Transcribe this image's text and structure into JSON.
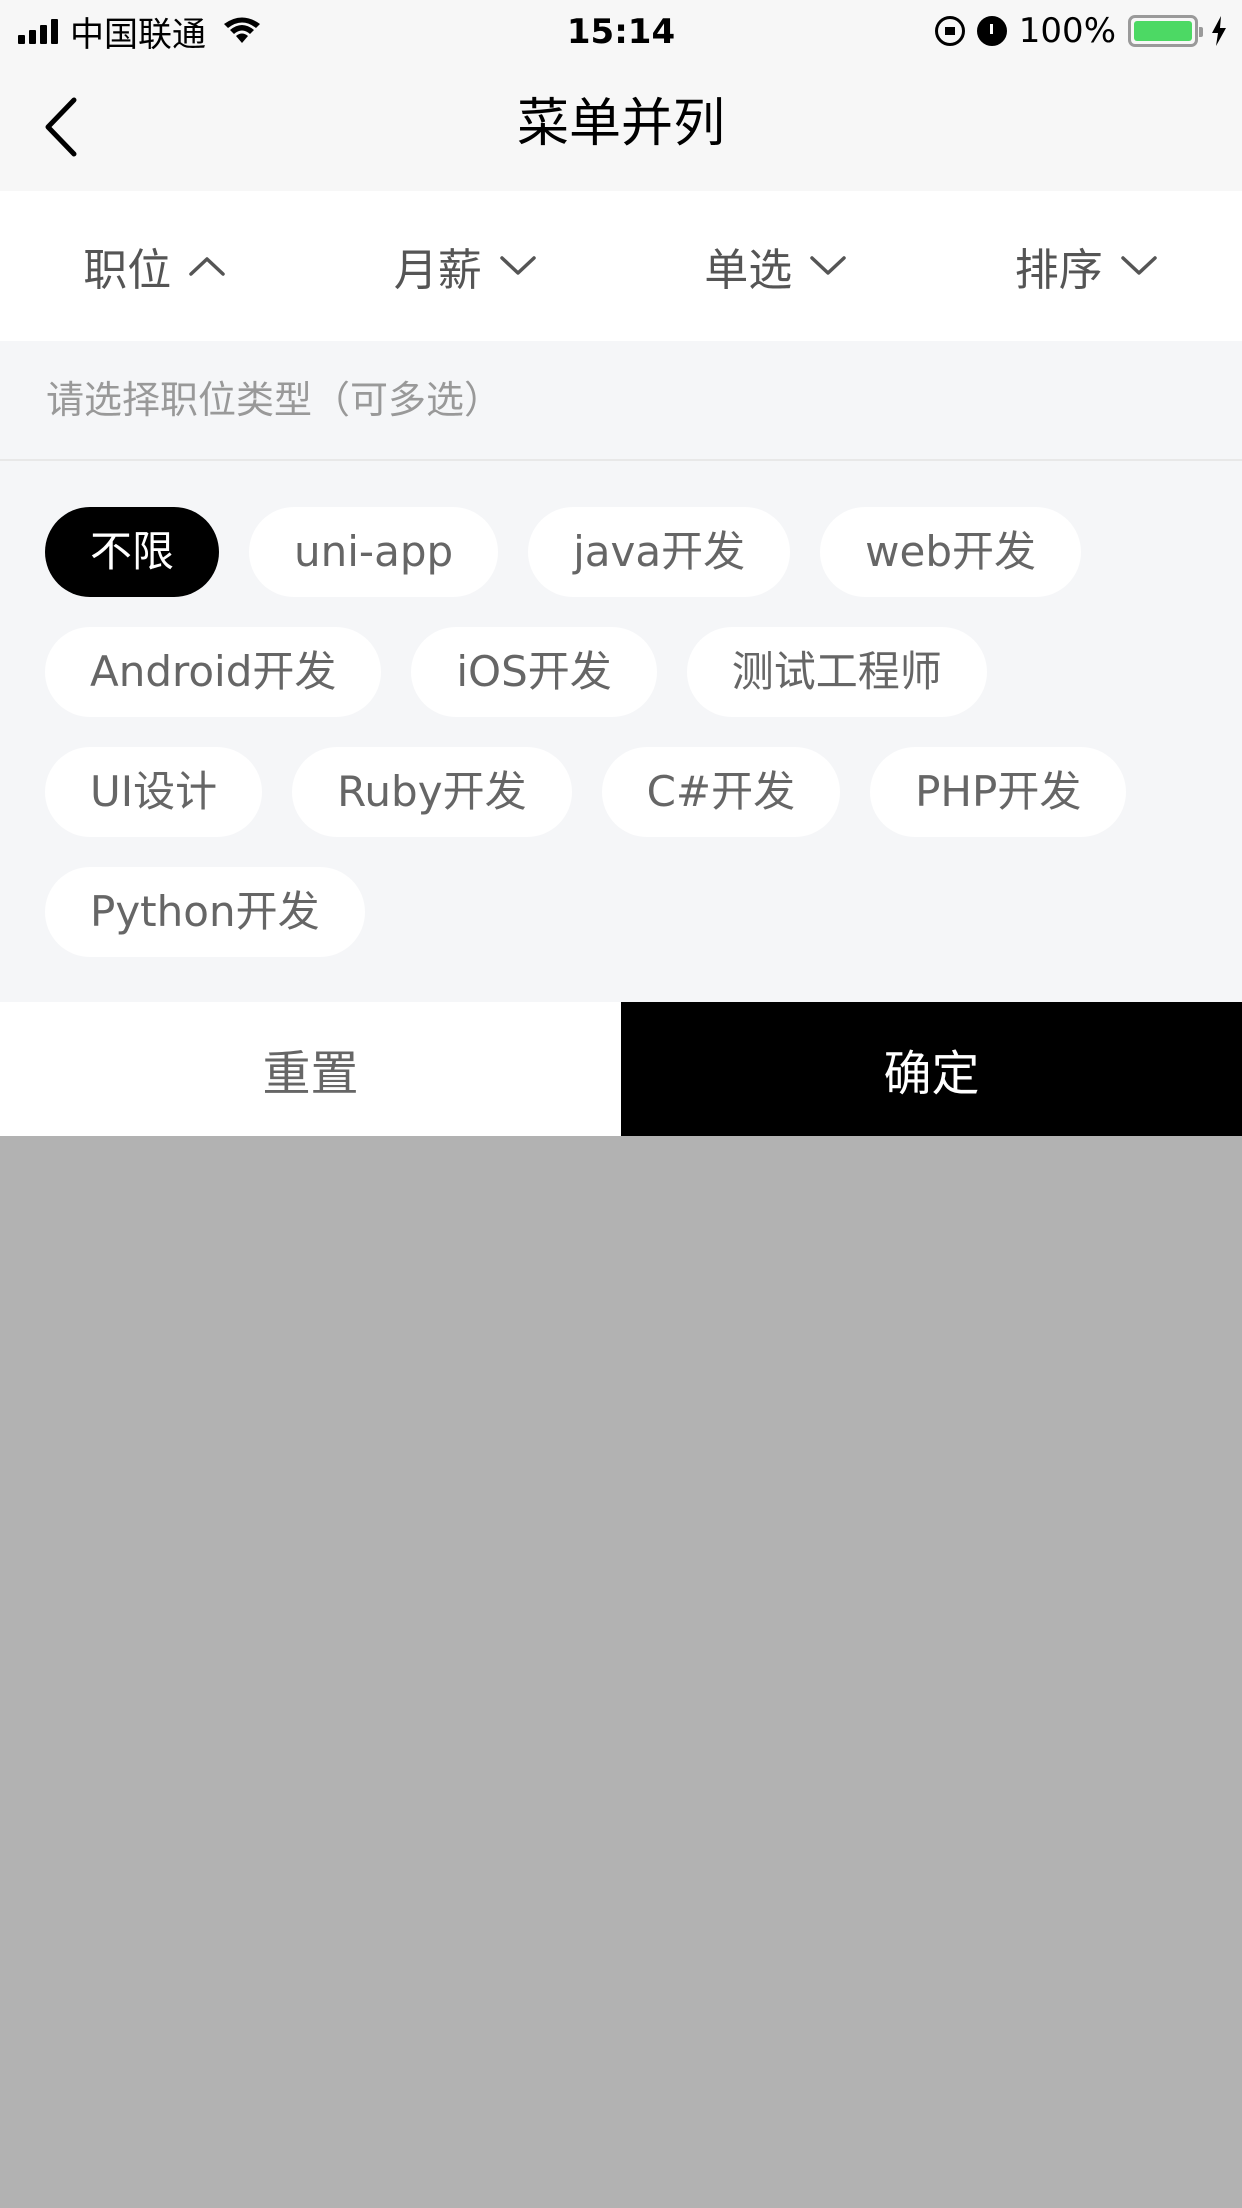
{
  "status_bar": {
    "carrier": "中国联通",
    "time": "15:14",
    "battery_percent": "100%",
    "battery_level": 1.0,
    "battery_color": "#4cd964"
  },
  "nav": {
    "title": "菜单并列",
    "back_icon": "chevron-left-icon"
  },
  "filter_tabs": [
    {
      "label": "职位",
      "icon": "chevron-up-icon",
      "expanded": true
    },
    {
      "label": "月薪",
      "icon": "chevron-down-icon",
      "expanded": false
    },
    {
      "label": "单选",
      "icon": "chevron-down-icon",
      "expanded": false
    },
    {
      "label": "排序",
      "icon": "chevron-down-icon",
      "expanded": false
    }
  ],
  "panel": {
    "hint": "请选择职位类型（可多选）",
    "options": [
      {
        "label": "不限",
        "selected": true
      },
      {
        "label": "uni-app",
        "selected": false
      },
      {
        "label": "java开发",
        "selected": false
      },
      {
        "label": "web开发",
        "selected": false
      },
      {
        "label": "Android开发",
        "selected": false
      },
      {
        "label": "iOS开发",
        "selected": false
      },
      {
        "label": "测试工程师",
        "selected": false
      },
      {
        "label": "UI设计",
        "selected": false
      },
      {
        "label": "Ruby开发",
        "selected": false
      },
      {
        "label": "C#开发",
        "selected": false
      },
      {
        "label": "PHP开发",
        "selected": false
      },
      {
        "label": "Python开发",
        "selected": false
      }
    ]
  },
  "footer": {
    "reset_label": "重置",
    "confirm_label": "确定"
  },
  "colors": {
    "accent": "#000000",
    "overlay": "#b2b2b2",
    "panel_bg": "#f5f6f8"
  }
}
